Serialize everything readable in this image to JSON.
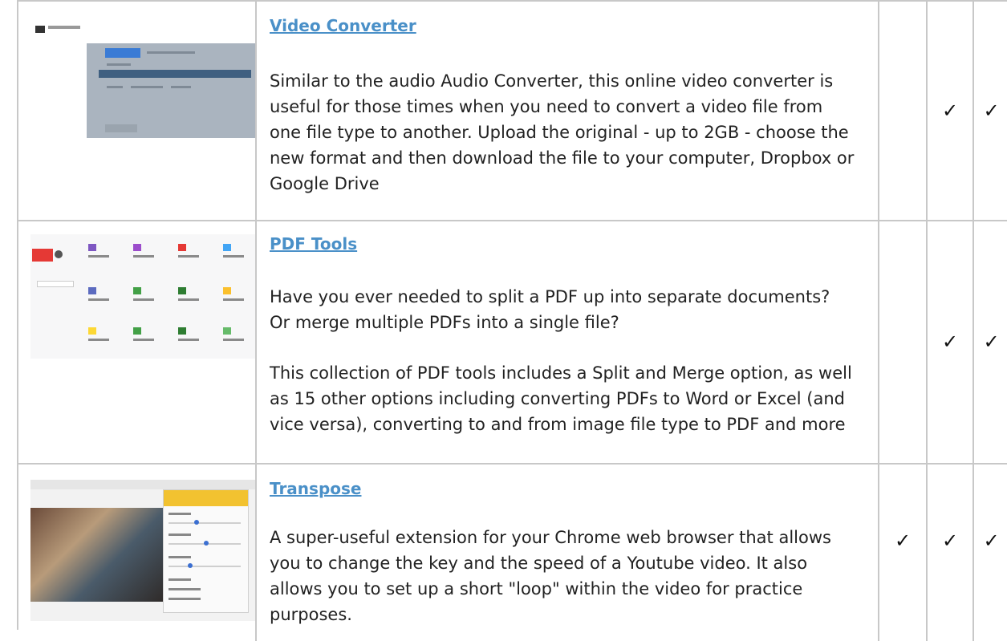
{
  "rows": [
    {
      "title": "Video Converter",
      "description": "Similar to the audio Audio Converter, this online video converter is useful for those times when you need to convert a video file from one file type to another. Upload the original - up to 2GB - choose the new format and then download the file to your computer, Dropbox or Google Drive",
      "checks": [
        "",
        "✓",
        "✓"
      ]
    },
    {
      "title": "PDF Tools",
      "description_1": "Have you ever needed to split a PDF up into separate documents? Or merge multiple PDFs into a single file?",
      "description_2": "This collection of PDF tools includes a Split and Merge option, as well as 15 other options including converting PDFs to Word or Excel (and vice versa), converting to and from image file type to PDF and more",
      "checks": [
        "",
        "✓",
        "✓"
      ]
    },
    {
      "title": "Transpose",
      "description": "A super-useful extension for your Chrome web browser that allows you to change the key and the speed of a Youtube video. It also allows you to set up a short \"loop\" within the video for practice purposes.",
      "checks": [
        "✓",
        "✓",
        "✓"
      ]
    }
  ]
}
